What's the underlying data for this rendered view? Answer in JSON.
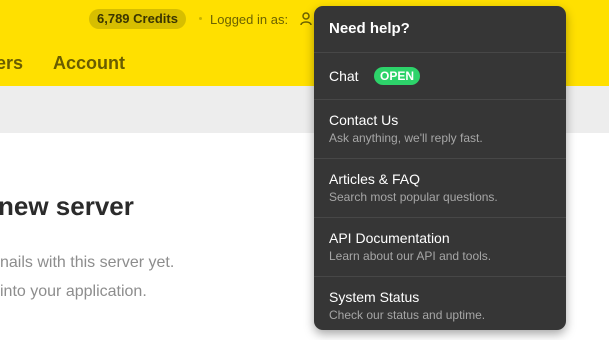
{
  "header": {
    "credits": "6,789 Credits",
    "logged_in_label": "Logged in as:"
  },
  "nav": {
    "items": [
      {
        "label": "ers"
      },
      {
        "label": "Account"
      }
    ]
  },
  "content": {
    "title": "new server",
    "line1": "nails with this server yet.",
    "line2": "into your application."
  },
  "help_menu": {
    "title": "Need help?",
    "items": [
      {
        "label": "Chat",
        "status": "OPEN"
      },
      {
        "label": "Contact Us",
        "description": "Ask anything, we'll reply fast."
      },
      {
        "label": "Articles & FAQ",
        "description": "Search most popular questions."
      },
      {
        "label": "API Documentation",
        "description": "Learn about our API and tools."
      },
      {
        "label": "System Status",
        "description": "Check our status and uptime."
      }
    ]
  },
  "colors": {
    "brand_yellow": "#ffe000",
    "menu_background": "#363636",
    "open_badge": "#2dd36a"
  },
  "icons": {
    "user": "user-icon"
  }
}
